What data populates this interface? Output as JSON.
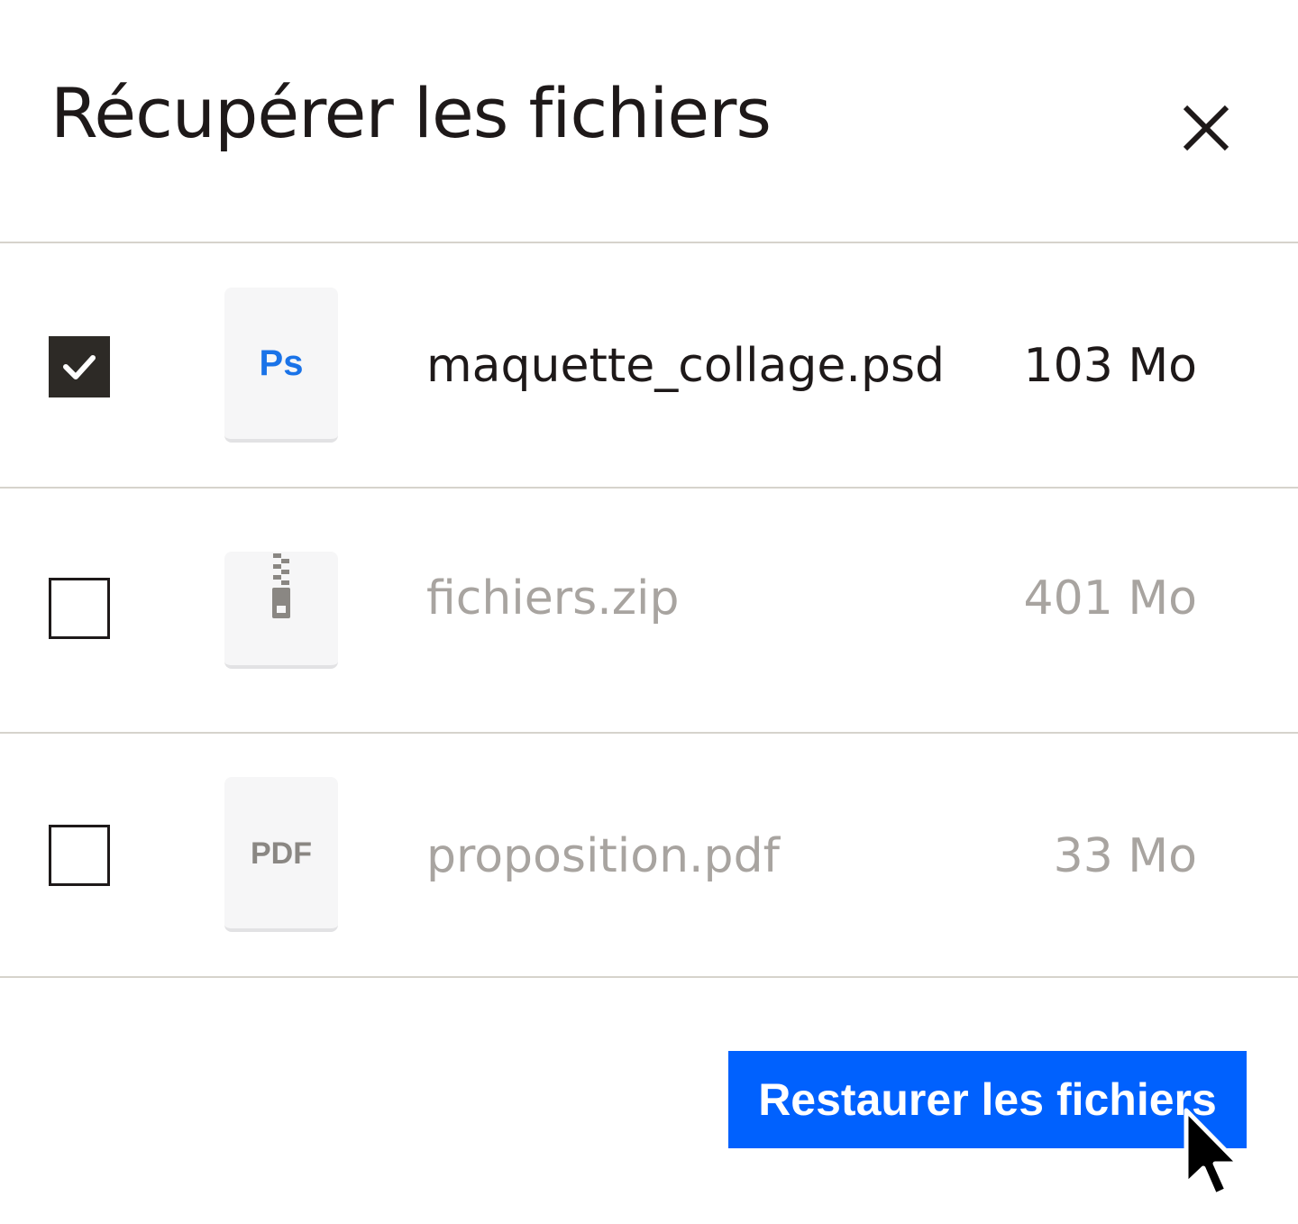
{
  "dialog": {
    "title": "Récupérer les fichiers",
    "close_icon": "close-icon"
  },
  "files": [
    {
      "name": "maquette_collage.psd",
      "size": "103 Mo",
      "checked": true,
      "icon": "photoshop-file-icon",
      "icon_label": "Ps",
      "icon_color": "#1a73e8"
    },
    {
      "name": "fichiers.zip",
      "size": "401 Mo",
      "checked": false,
      "icon": "zip-file-icon"
    },
    {
      "name": "proposition.pdf",
      "size": "33 Mo",
      "checked": false,
      "icon": "pdf-file-icon",
      "icon_label": "PDF"
    }
  ],
  "footer": {
    "restore_label": "Restaurer les fichiers",
    "button_color": "#0061fe"
  },
  "colors": {
    "checked_box": "#2d2a26",
    "divider": "#d6d3cc",
    "muted_text": "#a8a4a0"
  }
}
